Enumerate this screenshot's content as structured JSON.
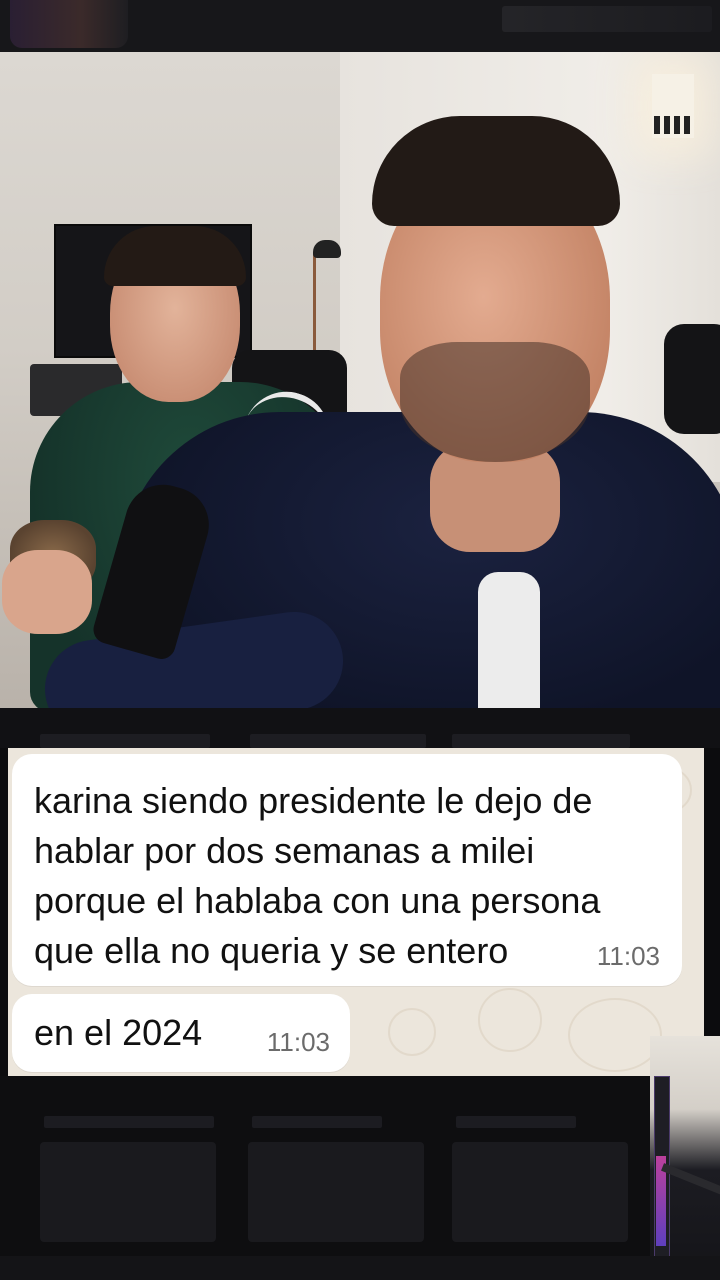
{
  "messages": [
    {
      "text": "karina siendo presidente le dejo de\nhablar por dos semanas a milei\nporque el hablaba con una persona\nque ella no queria y se entero",
      "time": "11:03"
    },
    {
      "text": "en el 2024",
      "time": "11:03"
    }
  ],
  "colors": {
    "chat_background": "#ece6dc",
    "bubble": "#ffffff",
    "text": "#111111",
    "time": "#6b6b6b"
  }
}
